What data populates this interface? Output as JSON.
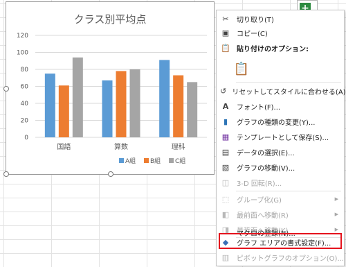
{
  "chart_data": {
    "type": "bar",
    "title": "クラス別平均点",
    "categories": [
      "国語",
      "算数",
      "理科"
    ],
    "series": [
      {
        "name": "A組",
        "values": [
          75,
          67,
          91
        ],
        "color": "#5b9bd5"
      },
      {
        "name": "B組",
        "values": [
          61,
          78,
          73
        ],
        "color": "#ed7d31"
      },
      {
        "name": "C組",
        "values": [
          94,
          80,
          65
        ],
        "color": "#a5a5a5"
      }
    ],
    "ylim": [
      0,
      120
    ],
    "yticks": [
      "0",
      "20",
      "40",
      "60",
      "80",
      "100",
      "120"
    ],
    "grid": true,
    "legend": "bottom"
  },
  "context_menu": {
    "cut": "切り取り(T)",
    "copy": "コピー(C)",
    "paste_header": "貼り付けのオプション:",
    "reset_style": "リセットしてスタイルに合わせる(A)",
    "font": "フォント(F)...",
    "change_chart_type": "グラフの種類の変更(Y)...",
    "save_template": "テンプレートとして保存(S)...",
    "select_data": "データの選択(E)...",
    "move_chart": "グラフの移動(V)...",
    "rotate_3d": "3-D 回転(R)...",
    "group": "グループ化(G)",
    "bring_front": "最前面へ移動(R)",
    "send_back": "最背面へ移動(K)",
    "assign_macro": "マクロの登録(N)...",
    "format_chart_area": "グラフ エリアの書式設定(F)...",
    "pivot_options": "ピボットグラフのオプション(O)..."
  },
  "ribbon": {
    "add_element_icon": "plus-icon"
  },
  "colors": {
    "highlight": "#e5131d",
    "a": "#5b9bd5",
    "b": "#ed7d31",
    "c": "#a5a5a5"
  }
}
